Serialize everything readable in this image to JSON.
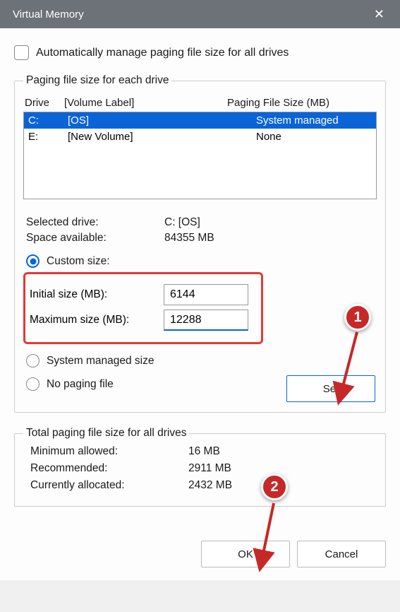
{
  "title": "Virtual Memory",
  "auto_manage": "Automatically manage paging file size for all drives",
  "group1": {
    "legend": "Paging file size for each drive",
    "headers": {
      "drive": "Drive",
      "volume": "[Volume Label]",
      "size": "Paging File Size (MB)"
    },
    "rows": [
      {
        "drive": "C:",
        "volume": "[OS]",
        "size": "System managed",
        "selected": true
      },
      {
        "drive": "E:",
        "volume": "[New Volume]",
        "size": "None",
        "selected": false
      }
    ],
    "selected_drive_label": "Selected drive:",
    "selected_drive_value": "C:  [OS]",
    "space_label": "Space available:",
    "space_value": "84355 MB",
    "radio_custom": "Custom size:",
    "initial_label": "Initial size (MB):",
    "initial_value": "6144",
    "max_label": "Maximum size (MB):",
    "max_value": "12288",
    "radio_system": "System managed size",
    "radio_none": "No paging file",
    "set": "Set"
  },
  "group2": {
    "legend": "Total paging file size for all drives",
    "min_label": "Minimum allowed:",
    "min_value": "16 MB",
    "rec_label": "Recommended:",
    "rec_value": "2911 MB",
    "cur_label": "Currently allocated:",
    "cur_value": "2432 MB"
  },
  "buttons": {
    "ok": "OK",
    "cancel": "Cancel"
  },
  "callouts": {
    "one": "1",
    "two": "2"
  },
  "colors": {
    "accent": "#0a64d8",
    "highlight": "#e53935",
    "callout": "#c62828"
  }
}
